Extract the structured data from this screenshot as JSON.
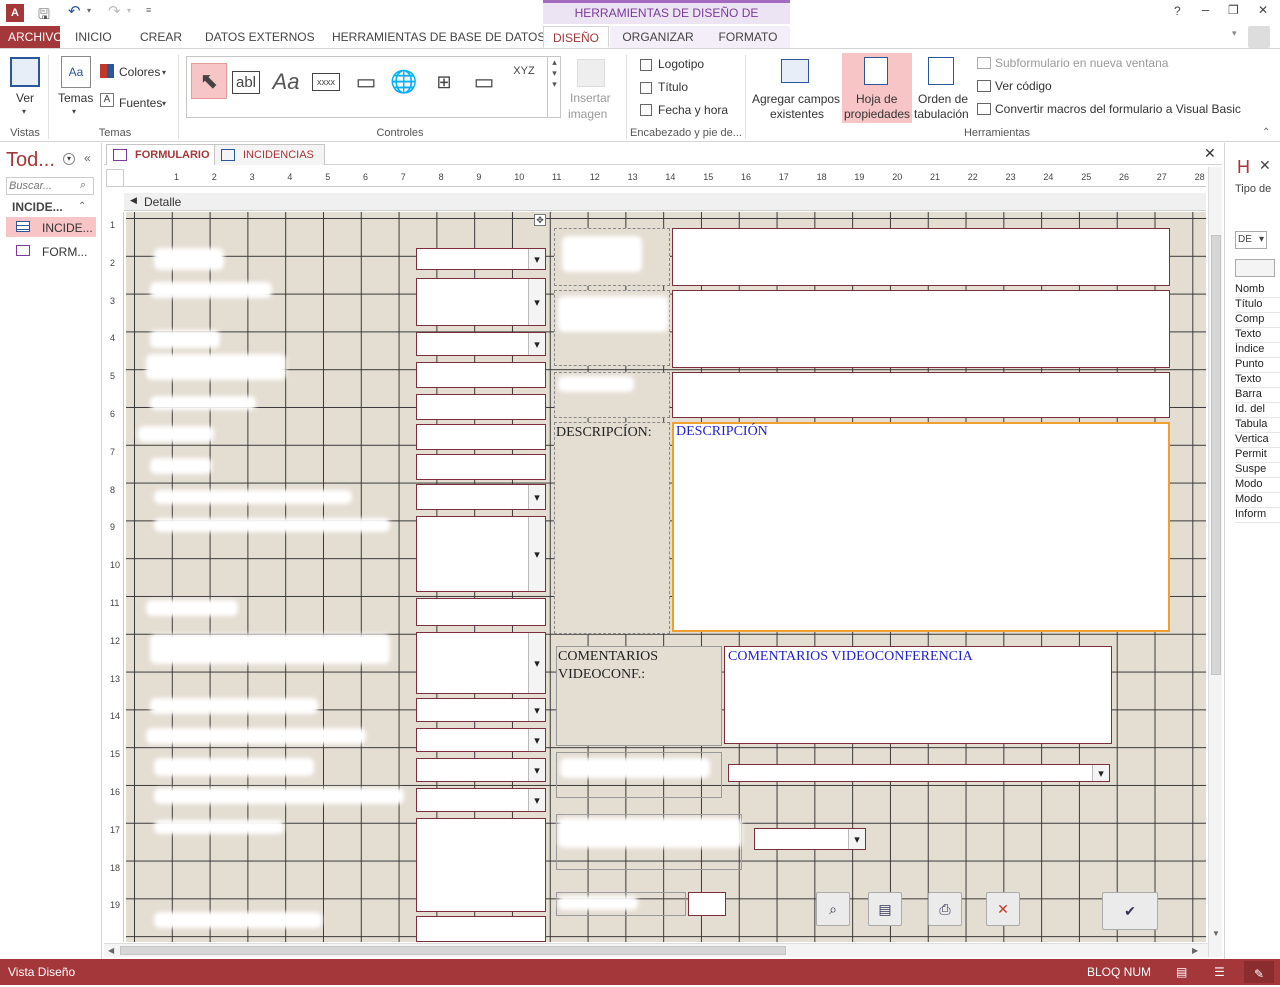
{
  "contextual_header": "HERRAMIENTAS DE DISEÑO DE FORMULARIO",
  "window_controls": {
    "help": "?",
    "minimize": "–",
    "restore": "❐",
    "close": "✕"
  },
  "tabs": [
    "ARCHIVO",
    "INICIO",
    "CREAR",
    "DATOS EXTERNOS",
    "HERRAMIENTAS DE BASE DE DATOS",
    "DISEÑO",
    "ORGANIZAR",
    "FORMATO"
  ],
  "active_tab": "DISEÑO",
  "ribbon": {
    "vistas": {
      "ver": "Ver",
      "group": "Vistas"
    },
    "temas": {
      "temas": "Temas",
      "colores": "Colores",
      "fuentes": "Fuentes",
      "group": "Temas"
    },
    "controles": {
      "group": "Controles",
      "xyz": "XYZ",
      "abl": "abl",
      "aa": "Aa",
      "xxxx": "xxxx",
      "insertar": "Insertar",
      "imagen": "imagen"
    },
    "encabezado": {
      "logotipo": "Logotipo",
      "titulo": "Título",
      "fecha": "Fecha y hora",
      "group": "Encabezado y pie de..."
    },
    "herramientas": {
      "agregar1": "Agregar campos",
      "agregar2": "existentes",
      "hoja1": "Hoja de",
      "hoja2": "propiedades",
      "orden1": "Orden de",
      "orden2": "tabulación",
      "subform": "Subformulario en nueva ventana",
      "vercodigo": "Ver código",
      "convertir": "Convertir macros del formulario a Visual Basic",
      "group": "Herramientas"
    }
  },
  "nav": {
    "title": "Tod...",
    "search_placeholder": "Buscar...",
    "group": "INCIDE...",
    "items": [
      "INCIDE...",
      "FORM..."
    ]
  },
  "doc_tabs": [
    "FORMULARIO",
    "INCIDENCIAS"
  ],
  "section_label": "Detalle",
  "ruler_h": [
    "1",
    "2",
    "3",
    "4",
    "5",
    "6",
    "7",
    "8",
    "9",
    "10",
    "11",
    "12",
    "13",
    "14",
    "15",
    "16",
    "17",
    "18",
    "19",
    "20",
    "21",
    "22",
    "23",
    "24",
    "25",
    "26",
    "27",
    "28"
  ],
  "ruler_v": [
    "1",
    "2",
    "3",
    "4",
    "5",
    "6",
    "7",
    "8",
    "9",
    "10",
    "11",
    "12",
    "13",
    "14",
    "15",
    "16",
    "17",
    "18",
    "19"
  ],
  "form": {
    "desc_label": "DESCRIPCÍON:",
    "desc_field": "DESCRIPCIÓN",
    "coment_label_1": "COMENTARIOS",
    "coment_label_2": "VIDEOCONF.:",
    "coment_field": "COMENTARIOS VIDEOCONFERENCIA"
  },
  "props": {
    "title": "H",
    "subtitle": "Tipo de",
    "select": "DE",
    "items": [
      "Nomb",
      "Título",
      "Comp",
      "Texto",
      "Índice",
      "Punto",
      "Texto",
      "Barra",
      "Id. del",
      "Tabula",
      "Vertica",
      "Permit",
      "Suspe",
      "Modo",
      "Modo",
      "Inform"
    ]
  },
  "status": {
    "left": "Vista Diseño",
    "right": "BLOQ NUM"
  }
}
